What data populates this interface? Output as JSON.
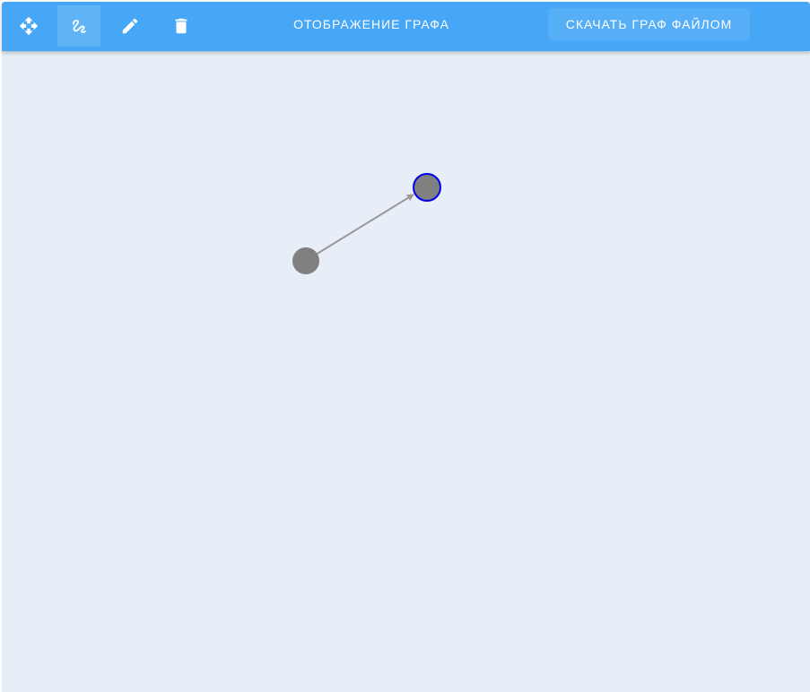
{
  "toolbar": {
    "title": "ОТОБРАЖЕНИЕ ГРАФА",
    "download_label": "СКАЧАТЬ ГРАФ ФАЙЛОМ",
    "tools": [
      {
        "icon": "move-icon",
        "active": false
      },
      {
        "icon": "draw-edge-icon",
        "active": true
      },
      {
        "icon": "pencil-icon",
        "active": false
      },
      {
        "icon": "trash-icon",
        "active": false
      }
    ]
  },
  "graph": {
    "nodes": [
      {
        "id": "node-1",
        "selected": false
      },
      {
        "id": "node-2",
        "selected": true
      }
    ],
    "edges": [
      {
        "from": "node-1",
        "to": "node-2",
        "directed": true
      }
    ]
  },
  "colors": {
    "toolbar": "#45a7f6",
    "canvas": "#e8eef7",
    "node": "#808080",
    "edge": "#999999",
    "selected_stroke": "#0000ee"
  }
}
